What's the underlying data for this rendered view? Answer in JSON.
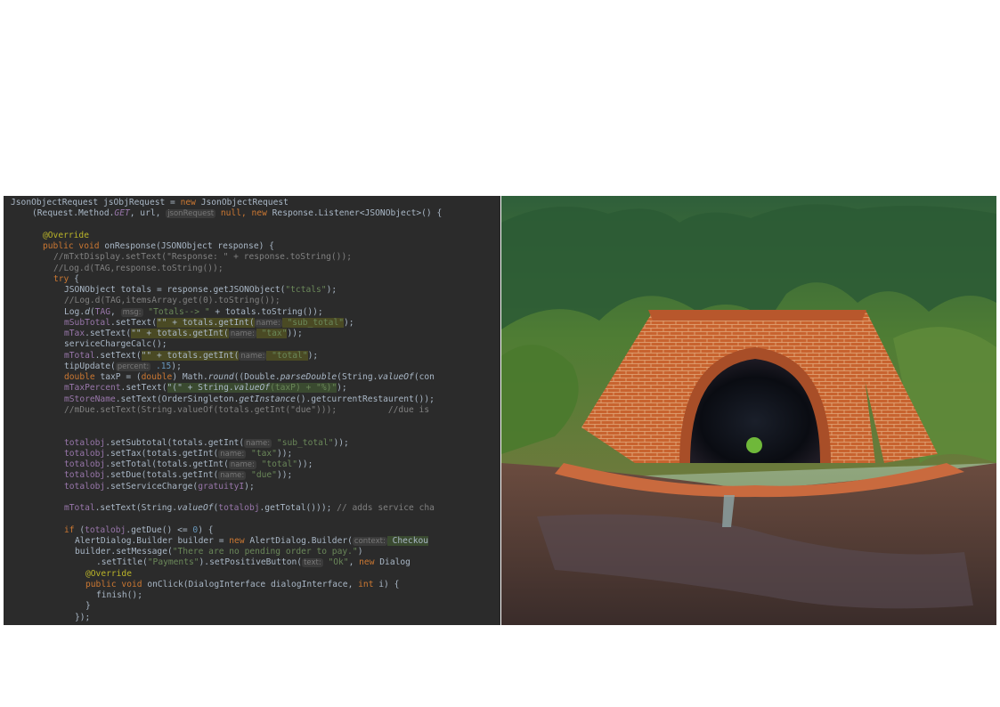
{
  "code_panel": {
    "lines": [
      {
        "indent": 0,
        "segs": [
          [
            "JsonObjectRequest jsObjRequest = ",
            ""
          ],
          [
            "new ",
            "kw"
          ],
          [
            "JsonObjectRequest",
            ""
          ]
        ]
      },
      {
        "indent": 4,
        "segs": [
          [
            "(Request.Method.",
            ""
          ],
          [
            "GET",
            "fld it"
          ],
          [
            ", url, ",
            ""
          ],
          [
            "jsonRequest",
            "hint"
          ],
          [
            " null, ",
            "kw"
          ],
          [
            "new ",
            "kw"
          ],
          [
            "Response.Listener<JSONObject>() {",
            ""
          ]
        ]
      },
      {
        "indent": 0,
        "segs": []
      },
      {
        "indent": 6,
        "segs": [
          [
            "@Override",
            "ann"
          ]
        ]
      },
      {
        "indent": 6,
        "segs": [
          [
            "public void ",
            "kw"
          ],
          [
            "onResponse",
            ""
          ],
          [
            "(JSONObject response) {",
            ""
          ]
        ]
      },
      {
        "indent": 8,
        "segs": [
          [
            "//mTxtDisplay.setText(\"Response: \" + response.toString());",
            "cmt"
          ]
        ]
      },
      {
        "indent": 8,
        "segs": [
          [
            "//Log.d(TAG,response.toString());",
            "cmt"
          ]
        ]
      },
      {
        "indent": 8,
        "segs": [
          [
            "try ",
            "kw"
          ],
          [
            "{",
            ""
          ]
        ]
      },
      {
        "indent": 10,
        "segs": [
          [
            "JSONObject totals = response.getJSONObject(",
            ""
          ],
          [
            "\"tctals\"",
            "str"
          ],
          [
            ");",
            ""
          ]
        ]
      },
      {
        "indent": 10,
        "segs": [
          [
            "//Log.d(TAG,itemsArray.get(0).toString());",
            "cmt"
          ]
        ]
      },
      {
        "indent": 10,
        "segs": [
          [
            "Log.",
            ""
          ],
          [
            "d",
            "it"
          ],
          [
            "(",
            ""
          ],
          [
            "TAG",
            "fld"
          ],
          [
            ", ",
            ""
          ],
          [
            "msg:",
            "hint"
          ],
          [
            " \"Totals--> \"",
            "str"
          ],
          [
            " + totals.toString());",
            ""
          ]
        ]
      },
      {
        "indent": 10,
        "segs": [
          [
            "mSubTotal",
            "fld"
          ],
          [
            ".setText(",
            ""
          ],
          [
            "\"\" + totals.getInt(",
            "hl"
          ],
          [
            "name:",
            "hint"
          ],
          [
            " \"sub_total\"",
            "str hl"
          ],
          [
            ");",
            ""
          ]
        ]
      },
      {
        "indent": 10,
        "segs": [
          [
            "mTax",
            "fld"
          ],
          [
            ".setText(",
            ""
          ],
          [
            "\"\" + totals.getInt(",
            "hl"
          ],
          [
            "name:",
            "hint"
          ],
          [
            " \"tax\"",
            "str hl"
          ],
          [
            "));",
            ""
          ]
        ]
      },
      {
        "indent": 10,
        "segs": [
          [
            "serviceChargeCalc();",
            ""
          ]
        ]
      },
      {
        "indent": 10,
        "segs": [
          [
            "mTotal",
            "fld"
          ],
          [
            ".setText(",
            ""
          ],
          [
            "\"\" + totals.getInt(",
            "hl"
          ],
          [
            "name:",
            "hint"
          ],
          [
            " \"total\"",
            "str hl"
          ],
          [
            ");",
            ""
          ]
        ]
      },
      {
        "indent": 10,
        "segs": [
          [
            "tipUpdate(",
            ""
          ],
          [
            "percent:",
            "hint"
          ],
          [
            " .15",
            "num"
          ],
          [
            ");",
            ""
          ]
        ]
      },
      {
        "indent": 10,
        "segs": [
          [
            "double ",
            "kw"
          ],
          [
            "taxP = (",
            ""
          ],
          [
            "double",
            "kw"
          ],
          [
            ") Math.",
            ""
          ],
          [
            "round",
            "it"
          ],
          [
            "((Double.",
            ""
          ],
          [
            "parseDouble",
            "it"
          ],
          [
            "(String.",
            ""
          ],
          [
            "valueOf",
            "it"
          ],
          [
            "(con",
            ""
          ]
        ]
      },
      {
        "indent": 10,
        "segs": [
          [
            "mTaxPercent",
            "fld"
          ],
          [
            ".setText(",
            ""
          ],
          [
            "\"(\" + String.",
            "hl2"
          ],
          [
            "valueOf",
            "it hl2"
          ],
          [
            "(taxP) + \"%)\"",
            "str hl2"
          ],
          [
            ");",
            ""
          ]
        ]
      },
      {
        "indent": 10,
        "segs": [
          [
            "mStoreName",
            "fld"
          ],
          [
            ".setText(OrderSingleton.",
            ""
          ],
          [
            "getInstance",
            "it"
          ],
          [
            "().getcurrentRestaurent());",
            ""
          ]
        ]
      },
      {
        "indent": 10,
        "segs": [
          [
            "//mDue.setText(String.valueOf(totals.getInt(\"due\")));          //due is",
            "cmt"
          ]
        ]
      },
      {
        "indent": 0,
        "segs": []
      },
      {
        "indent": 0,
        "segs": []
      },
      {
        "indent": 10,
        "segs": [
          [
            "totalobj",
            "fld"
          ],
          [
            ".setSubtotal(totals.getInt(",
            ""
          ],
          [
            "name:",
            "hint"
          ],
          [
            " \"sub_total\"",
            "str"
          ],
          [
            "));",
            ""
          ]
        ]
      },
      {
        "indent": 10,
        "segs": [
          [
            "totalobj",
            "fld"
          ],
          [
            ".setTax(totals.getInt(",
            ""
          ],
          [
            "name:",
            "hint"
          ],
          [
            " \"tax\"",
            "str"
          ],
          [
            "));",
            ""
          ]
        ]
      },
      {
        "indent": 10,
        "segs": [
          [
            "totalobj",
            "fld"
          ],
          [
            ".setTotal(totals.getInt(",
            ""
          ],
          [
            "name:",
            "hint"
          ],
          [
            " \"total\"",
            "str"
          ],
          [
            "));",
            ""
          ]
        ]
      },
      {
        "indent": 10,
        "segs": [
          [
            "totalobj",
            "fld"
          ],
          [
            ".setDue(totals.getInt(",
            ""
          ],
          [
            "name:",
            "hint"
          ],
          [
            " \"due\"",
            "str"
          ],
          [
            "));",
            ""
          ]
        ]
      },
      {
        "indent": 10,
        "segs": [
          [
            "totalobj",
            "fld"
          ],
          [
            ".setServiceCharge(",
            ""
          ],
          [
            "gratuityI",
            "fld"
          ],
          [
            ");",
            ""
          ]
        ]
      },
      {
        "indent": 0,
        "segs": []
      },
      {
        "indent": 10,
        "segs": [
          [
            "mTotal",
            "fld"
          ],
          [
            ".setText(String.",
            ""
          ],
          [
            "valueOf",
            "it"
          ],
          [
            "(",
            ""
          ],
          [
            "totalobj",
            "fld"
          ],
          [
            ".getTotal())); ",
            ""
          ],
          [
            "// adds service cha",
            "cmt"
          ]
        ]
      },
      {
        "indent": 0,
        "segs": []
      },
      {
        "indent": 10,
        "segs": [
          [
            "if ",
            "kw"
          ],
          [
            "(",
            ""
          ],
          [
            "totalobj",
            "fld"
          ],
          [
            ".getDue() <= ",
            ""
          ],
          [
            "0",
            "num"
          ],
          [
            ") {",
            ""
          ]
        ]
      },
      {
        "indent": 12,
        "segs": [
          [
            "AlertDialog.Builder builder = ",
            ""
          ],
          [
            "new ",
            "kw"
          ],
          [
            "AlertDialog.Builder(",
            ""
          ],
          [
            "context:",
            "hint"
          ],
          [
            " Checkou",
            "hl2"
          ]
        ]
      },
      {
        "indent": 12,
        "segs": [
          [
            "builder.setMessage(",
            ""
          ],
          [
            "\"There are no pending order to pay.\"",
            "str"
          ],
          [
            ")",
            ""
          ]
        ]
      },
      {
        "indent": 16,
        "segs": [
          [
            ".setTitle(",
            ""
          ],
          [
            "\"Payments\"",
            "str"
          ],
          [
            ").setPositiveButton(",
            ""
          ],
          [
            "text:",
            "hint"
          ],
          [
            " \"Ok\"",
            "str"
          ],
          [
            ", ",
            ""
          ],
          [
            "new ",
            "kw"
          ],
          [
            "Dialog",
            ""
          ]
        ]
      },
      {
        "indent": 14,
        "segs": [
          [
            "@Override",
            "ann"
          ]
        ]
      },
      {
        "indent": 14,
        "segs": [
          [
            "public void ",
            "kw"
          ],
          [
            "onClick",
            ""
          ],
          [
            "(DialogInterface dialogInterface, ",
            ""
          ],
          [
            "int ",
            "kw"
          ],
          [
            "i) {",
            ""
          ]
        ]
      },
      {
        "indent": 16,
        "segs": [
          [
            "finish();",
            ""
          ]
        ]
      },
      {
        "indent": 14,
        "segs": [
          [
            "}",
            ""
          ]
        ]
      },
      {
        "indent": 12,
        "segs": [
          [
            "});",
            ""
          ]
        ]
      }
    ]
  }
}
